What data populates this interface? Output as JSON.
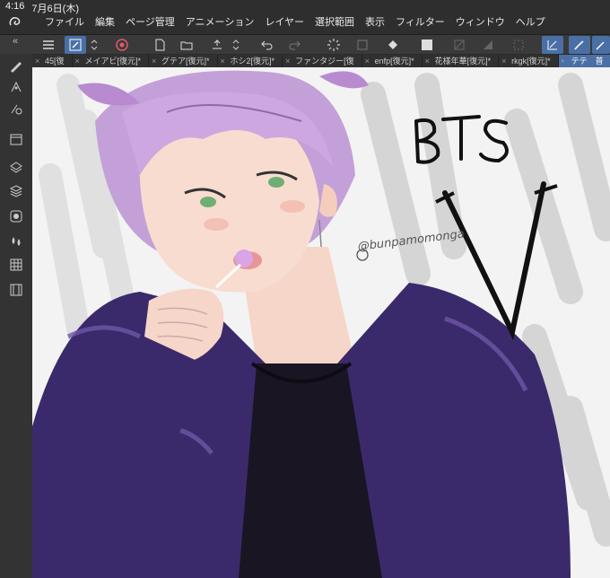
{
  "status": {
    "time": "4:16",
    "date": "7月6日(木)"
  },
  "menu": [
    "ファイル",
    "編集",
    "ページ管理",
    "アニメーション",
    "レイヤー",
    "選択範囲",
    "表示",
    "フィルター",
    "ウィンドウ",
    "ヘルプ"
  ],
  "tabs": [
    {
      "label": "45[復"
    },
    {
      "label": "メイアビ[復元]*"
    },
    {
      "label": "グテア[復元]*"
    },
    {
      "label": "ホシ2[復元]*"
    },
    {
      "label": "ファンタジー[復"
    },
    {
      "label": "enfp[復元]*"
    },
    {
      "label": "花様年華[復元]*"
    },
    {
      "label": "rkgk[復元]*"
    },
    {
      "label": "テテ　普",
      "active": true
    }
  ],
  "artwork": {
    "title_text": "BTS",
    "subtitle_text": "V",
    "signature": "@bunpamomonga"
  },
  "colors": {
    "accent": "#4a6fa5",
    "hair": "#c4a0d8",
    "jacket": "#3b2a6b",
    "shirt": "#1a1522"
  }
}
